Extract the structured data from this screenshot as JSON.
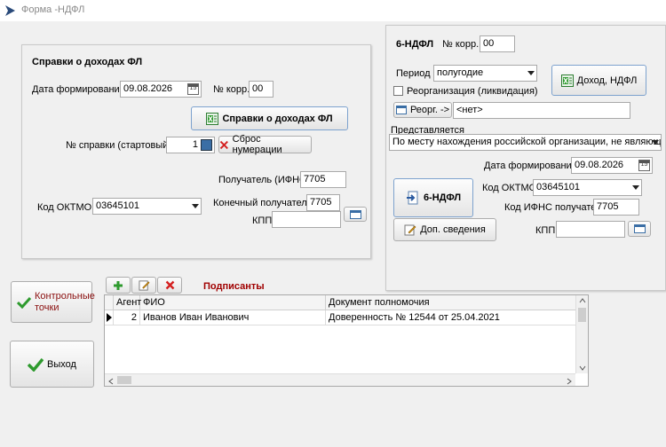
{
  "window": {
    "title": "Форма -НДФЛ"
  },
  "spravki": {
    "title": "Справки о доходах ФЛ",
    "date_label": "Дата формирования",
    "date_value": "09.08.2026",
    "korr_label": "№ корр.",
    "korr_value": "00",
    "main_button": "Справки о доходах ФЛ",
    "start_num_label": "№ справки (стартовый)",
    "start_num_value": "1",
    "reset_button": "Сброс нумерации",
    "recipient_label": "Получатель (ИФНС)",
    "recipient_value": "7705",
    "final_recipient_label": "Конечный получатель",
    "final_recipient_value": "7705",
    "oktmo_label": "Код ОКТМО",
    "oktmo_value": "03645101",
    "kpp_label": "КПП",
    "kpp_value": ""
  },
  "ndfl6": {
    "title": "6-НДФЛ",
    "korr_label": "№ корр.",
    "korr_value": "00",
    "period_label": "Период",
    "period_value": "полугодие",
    "income_button": "Доход, НДФЛ",
    "reorg_check_label": "Реорганизация (ликвидация)",
    "reorg_button": "Реорг. ->",
    "reorg_value": "<нет>",
    "presented_label": "Представляется",
    "presented_value": "По месту нахождения российской организации, не являющейс",
    "date_label": "Дата формирования",
    "date_value": "09.08.2026",
    "main_button": "6-НДФЛ",
    "oktmo_label": "Код ОКТМО",
    "oktmo_value": "03645101",
    "ifns_label": "Код ИФНС получателя",
    "ifns_value": "7705",
    "extra_button": "Доп. сведения",
    "kpp_label": "КПП",
    "kpp_value": ""
  },
  "buttons": {
    "control_points": "Контрольные точки",
    "exit": "Выход"
  },
  "signers": {
    "title": "Подписанты",
    "columns": [
      "Агент",
      "ФИО",
      "Документ полномочия"
    ],
    "rows": [
      {
        "agent": "2",
        "fio": "Иванов Иван Иванович",
        "doc": "Доверенность № 12544 от 25.04.2021"
      }
    ]
  },
  "colors": {
    "accent_green": "#2e9a2e",
    "delete_red": "#d42020",
    "signers_title": "#a00000"
  }
}
